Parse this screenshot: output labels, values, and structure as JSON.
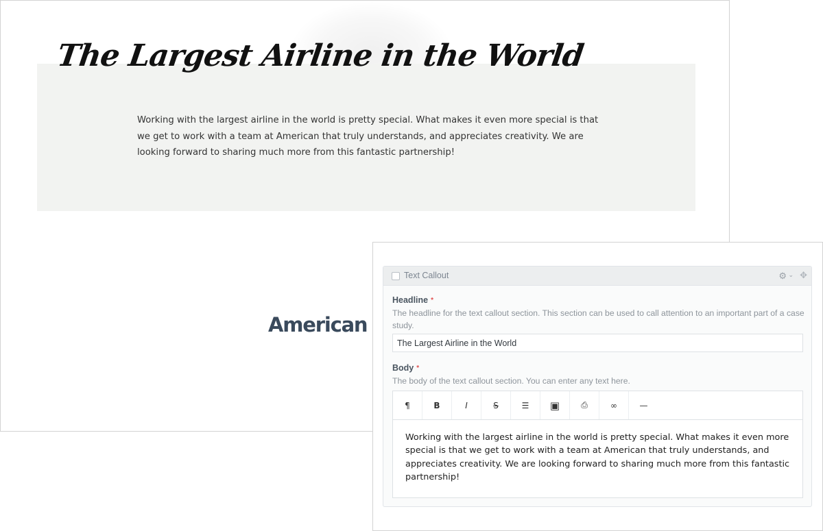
{
  "preview": {
    "headline": "The Largest Airline in the World",
    "body": "Working with the largest airline in the world is pretty special. What makes it even more special is that we get to work with a team at American that truly understands, and appreciates creativity. We are looking forward to sharing much more from this fantastic partnership!",
    "brand_text": "American Ai"
  },
  "editor": {
    "module_title": "Text Callout",
    "headline_field": {
      "label": "Headline",
      "required_mark": "*",
      "help": "The headline for the text callout section. This section can be used to call attention to an important part of a case study.",
      "value": "The Largest Airline in the World"
    },
    "body_field": {
      "label": "Body",
      "required_mark": "*",
      "help": "The body of the text callout section. You can enter any text here.",
      "content": "Working with the largest airline in the world is pretty special. What makes it even more special is that we get to work with a team at American that truly understands, and appreciates creativity. We are looking forward to sharing much more from this fantastic partnership!"
    },
    "toolbar": {
      "paragraph": "¶",
      "bold": "B",
      "italic": "I",
      "strikethrough": "S̶",
      "list": "☰",
      "image": "▣",
      "embed": "⎙",
      "link": "∞",
      "hr": "—"
    },
    "icons": {
      "gear": "⚙",
      "chevron": "⌄",
      "move": "✥"
    }
  },
  "colors": {
    "callout_band": "#f2f3f1",
    "brand": "#3a4a5c",
    "required": "#e05050"
  }
}
